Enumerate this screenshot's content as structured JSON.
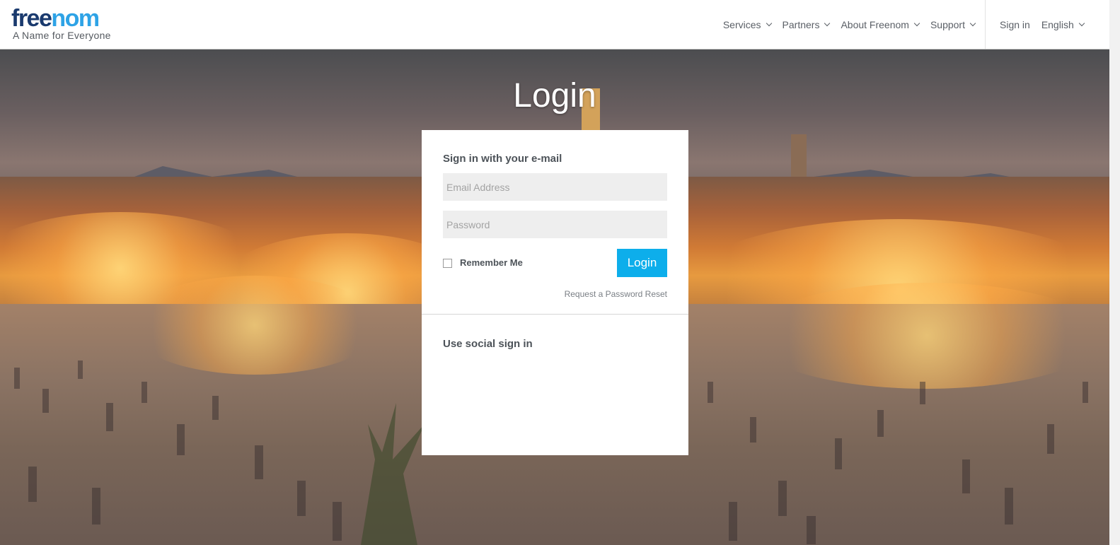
{
  "header": {
    "logo": {
      "part1": "free",
      "part2": "nom",
      "tagline": "A Name for Everyone",
      "colors": {
        "dark": "#1a3a6e",
        "light": "#2ea3e6"
      }
    },
    "nav": [
      "Services",
      "Partners",
      "About Freenom",
      "Support"
    ],
    "sign_in": "Sign in",
    "language": "English"
  },
  "page_title": "Login",
  "login_card": {
    "heading": "Sign in with your e-mail",
    "email_placeholder": "Email Address",
    "password_placeholder": "Password",
    "remember_label": "Remember Me",
    "login_button": "Login",
    "reset_link": "Request a Password Reset",
    "social_heading": "Use social sign in"
  },
  "colors": {
    "accent": "#0daeeb"
  }
}
